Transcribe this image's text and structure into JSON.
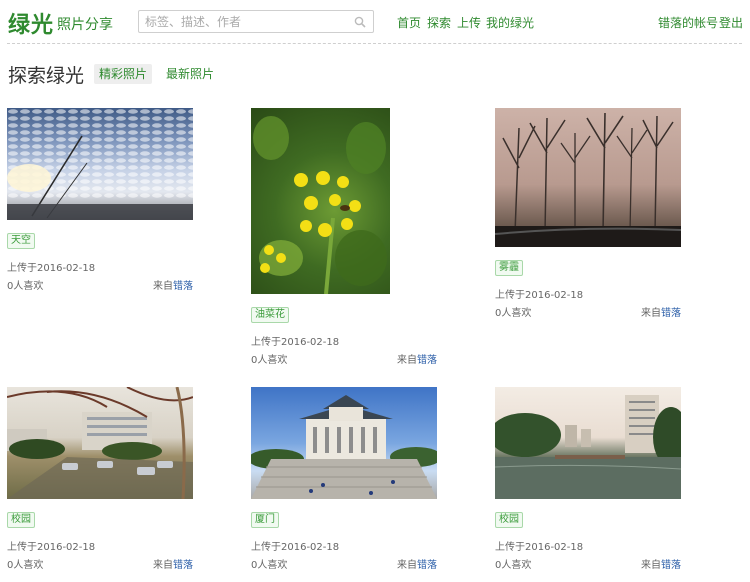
{
  "header": {
    "logo": "绿光",
    "subtitle": "照片分享",
    "search_placeholder": "标签、描述、作者",
    "nav": [
      "首页",
      "探索",
      "上传",
      "我的绿光"
    ],
    "account": "错落的帐号",
    "logout": "登出"
  },
  "section": {
    "title": "探索绿光",
    "tabs": [
      "精彩照片",
      "最新照片"
    ],
    "active_tab": "精彩照片"
  },
  "colors": {
    "brand": "#2f8a2f",
    "link": "#2b5ea8",
    "tag_bg": "#f1faf1"
  },
  "photos": [
    {
      "tag": "天空",
      "date": "上传于2016-02-18",
      "likes": "0人喜欢",
      "from_prefix": "来自",
      "author": "错落"
    },
    {
      "tag": "油菜花",
      "date": "上传于2016-02-18",
      "likes": "0人喜欢",
      "from_prefix": "来自",
      "author": "错落"
    },
    {
      "tag": "雾霾",
      "date": "上传于2016-02-18",
      "likes": "0人喜欢",
      "from_prefix": "来自",
      "author": "错落"
    },
    {
      "tag": "校园",
      "date": "上传于2016-02-18",
      "likes": "0人喜欢",
      "from_prefix": "来自",
      "author": "错落"
    },
    {
      "tag": "厦门",
      "date": "上传于2016-02-18",
      "likes": "0人喜欢",
      "from_prefix": "来自",
      "author": "错落"
    },
    {
      "tag": "校园",
      "date": "上传于2016-02-18",
      "likes": "0人喜欢",
      "from_prefix": "来自",
      "author": "错落"
    }
  ]
}
